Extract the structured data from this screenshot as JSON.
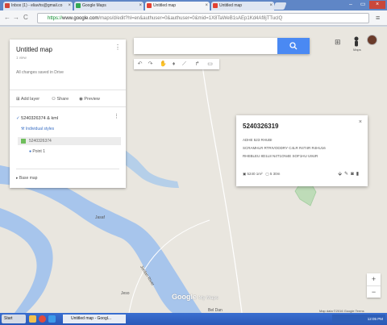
{
  "tabs": [
    {
      "label": "Inbox (1) - eliavhs@gmail.co",
      "color": "#d44638",
      "active": false
    },
    {
      "label": "Google Maps",
      "color": "#34a853",
      "active": false
    },
    {
      "label": "Untitled map",
      "color": "#e34133",
      "active": true
    },
    {
      "label": "Untitled map",
      "color": "#e34133",
      "active": false
    }
  ],
  "address": {
    "https": "https://",
    "host": "www.google.com",
    "path": "/maps/d/edit?hl=en&authuser=0&authuser=0&mid=1X8TaWeB1sAEp1Kd4Af8jTTuclQ"
  },
  "panel": {
    "title": "Untitled map",
    "subtitle": "1 view",
    "description": "All changes saved in Drive",
    "actions": {
      "add_layer": "Add layer",
      "share": "Share",
      "preview": "Preview"
    },
    "layer_name": "5240326374 & kml",
    "style_link": "Individual styles",
    "field_name": "5240326374",
    "point_label": "Point 1",
    "base_map": "Base map"
  },
  "search": {
    "placeholder": ""
  },
  "card": {
    "title": "5240326319",
    "lines": [
      "ADHE 523 RHUBI",
      "SCRAMHLR RTRIVODDRY C4LR R4T4R R4HU16",
      "RHEBLEU 8D1L8 N4T1ON4E SOF1HU U9UR"
    ],
    "footer_a": "5240 1m²",
    "footer_b": "5 30m"
  },
  "map_labels": {
    "town1": "Jasaf",
    "town2": "Jeso",
    "place": "Bel Dan",
    "river": "Jordan River"
  },
  "logo": {
    "google": "Google",
    "my_maps": "My Maps"
  },
  "map_data": "Map data ©2016 Google  Terms",
  "taskbar": {
    "start": "Start",
    "window": "Untitled map - Googl...",
    "clock": "12:05 PM"
  },
  "user": {
    "maps_label": "Maps"
  }
}
